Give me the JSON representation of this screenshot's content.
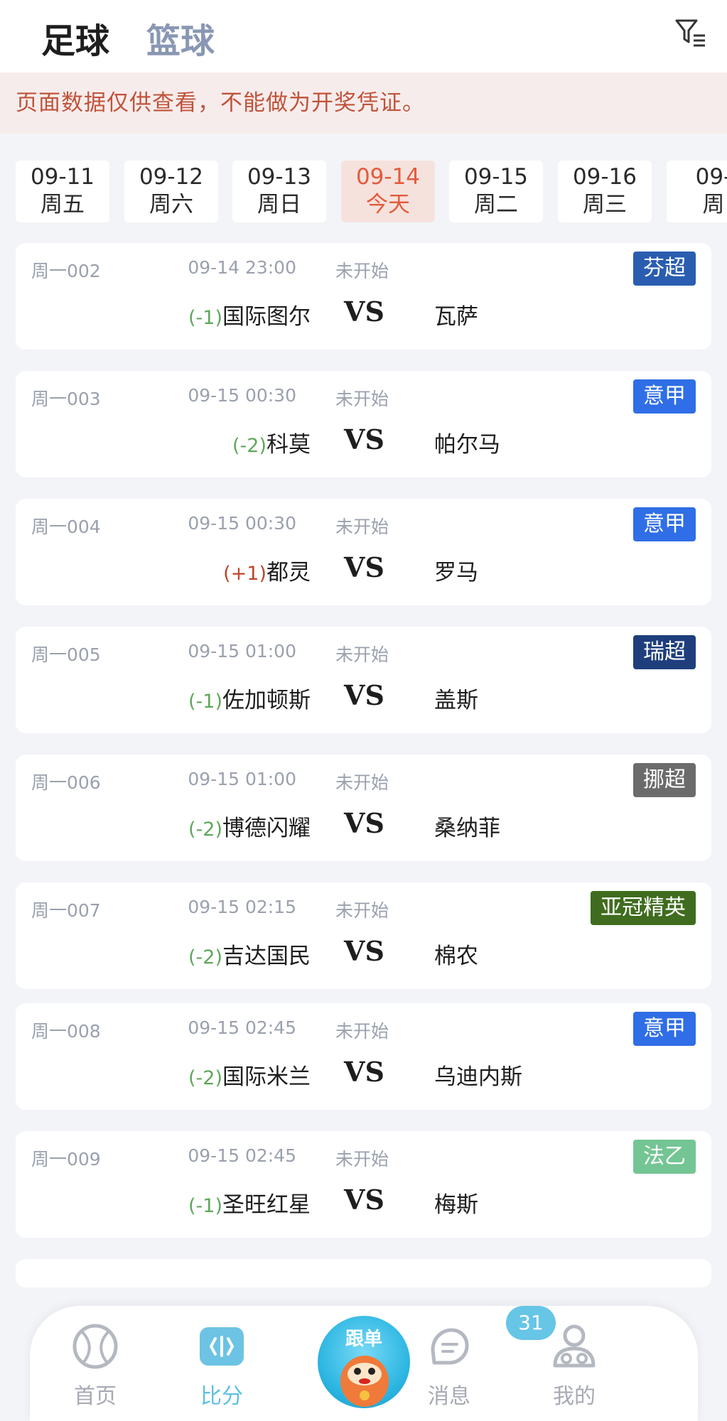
{
  "header": {
    "tabs": [
      {
        "label": "足球",
        "active": true
      },
      {
        "label": "篮球",
        "active": false
      }
    ],
    "filter_icon": "filter-icon"
  },
  "notice": "页面数据仅供查看，不能做为开奖凭证。",
  "dates": [
    {
      "date": "09-11",
      "weekday": "周五",
      "active": false
    },
    {
      "date": "09-12",
      "weekday": "周六",
      "active": false
    },
    {
      "date": "09-13",
      "weekday": "周日",
      "active": false
    },
    {
      "date": "09-14",
      "weekday": "今天",
      "active": true
    },
    {
      "date": "09-15",
      "weekday": "周二",
      "active": false
    },
    {
      "date": "09-16",
      "weekday": "周三",
      "active": false
    },
    {
      "date": "09-",
      "weekday": "周",
      "active": false
    }
  ],
  "matches": [
    {
      "code": "周一002",
      "time": "09-14 23:00",
      "status": "未开始",
      "league": "芬超",
      "league_color": "#2a5db0",
      "handicap": "(-1)",
      "home": "国际图尔",
      "vs": "VS",
      "away": "瓦萨"
    },
    {
      "code": "周一003",
      "time": "09-15 00:30",
      "status": "未开始",
      "league": "意甲",
      "league_color": "#2f6ee6",
      "handicap": "(-2)",
      "home": "科莫",
      "vs": "VS",
      "away": "帕尔马"
    },
    {
      "code": "周一004",
      "time": "09-15 00:30",
      "status": "未开始",
      "league": "意甲",
      "league_color": "#2f6ee6",
      "handicap": "(+1)",
      "home": "都灵",
      "vs": "VS",
      "away": "罗马"
    },
    {
      "code": "周一005",
      "time": "09-15 01:00",
      "status": "未开始",
      "league": "瑞超",
      "league_color": "#1e3f7c",
      "handicap": "(-1)",
      "home": "佐加顿斯",
      "vs": "VS",
      "away": "盖斯"
    },
    {
      "code": "周一006",
      "time": "09-15 01:00",
      "status": "未开始",
      "league": "挪超",
      "league_color": "#6b6b6b",
      "handicap": "(-2)",
      "home": "博德闪耀",
      "vs": "VS",
      "away": "桑纳菲"
    },
    {
      "code": "周一007",
      "time": "09-15 02:15",
      "status": "未开始",
      "league": "亚冠精英",
      "league_color": "#3f6c1e",
      "handicap": "(-2)",
      "home": "吉达国民",
      "vs": "VS",
      "away": "棉农"
    },
    {
      "code": "周一008",
      "time": "09-15 02:45",
      "status": "未开始",
      "league": "意甲",
      "league_color": "#2f6ee6",
      "handicap": "(-2)",
      "home": "国际米兰",
      "vs": "VS",
      "away": "乌迪内斯"
    },
    {
      "code": "周一009",
      "time": "09-15 02:45",
      "status": "未开始",
      "league": "法乙",
      "league_color": "#74c594",
      "handicap": "(-1)",
      "home": "圣旺红星",
      "vs": "VS",
      "away": "梅斯"
    }
  ],
  "bottom_nav": {
    "items": [
      {
        "label": "首页",
        "icon": "football-icon",
        "active": false
      },
      {
        "label": "比分",
        "icon": "score-icon",
        "active": true
      },
      {
        "label": "跟单",
        "icon": "mascot-icon",
        "active": false
      },
      {
        "label": "消息",
        "icon": "message-icon",
        "active": false
      },
      {
        "label": "我的",
        "icon": "user-icon",
        "active": false
      }
    ],
    "message_badge": "31"
  },
  "colors": {
    "accent": "#e35b3c",
    "active_nav": "#5fc0e0",
    "handicap_negative": "#5fa85a",
    "handicap_positive": "#c0442a"
  }
}
